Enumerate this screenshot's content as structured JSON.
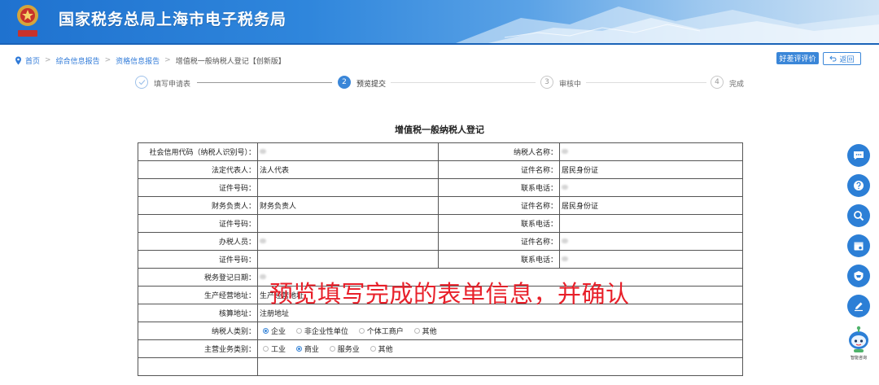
{
  "header": {
    "site_title": "国家税务总局上海市电子税务局"
  },
  "breadcrumb": {
    "items": [
      "首页",
      "综合信息报告",
      "资格信息报告"
    ],
    "current": "增值税一般纳税人登记【创新版】"
  },
  "actions": {
    "evaluate_label": "好差评评价",
    "back_label": "返回"
  },
  "steps": [
    {
      "num": "1",
      "label": "填写申请表",
      "state": "done"
    },
    {
      "num": "2",
      "label": "预览提交",
      "state": "active"
    },
    {
      "num": "3",
      "label": "审核中",
      "state": "todo"
    },
    {
      "num": "4",
      "label": "完成",
      "state": "todo"
    }
  ],
  "form": {
    "title": "增值税一般纳税人登记",
    "rows": [
      {
        "l1": "社会信用代码（纳税人识别号）：",
        "v1": "",
        "l2": "纳税人名称：",
        "v2": ""
      },
      {
        "l1": "法定代表人：",
        "v1": "法人代表",
        "l2": "证件名称：",
        "v2": "居民身份证"
      },
      {
        "l1": "证件号码：",
        "v1": "",
        "l2": "联系电话：",
        "v2": ""
      },
      {
        "l1": "财务负责人：",
        "v1": "财务负责人",
        "l2": "证件名称：",
        "v2": "居民身份证"
      },
      {
        "l1": "证件号码：",
        "v1": "",
        "l2": "联系电话：",
        "v2": ""
      },
      {
        "l1": "办税人员：",
        "v1": "",
        "l2": "证件名称：",
        "v2": ""
      },
      {
        "l1": "证件号码：",
        "v1": "",
        "l2": "联系电话：",
        "v2": ""
      }
    ],
    "full_rows": [
      {
        "label": "税务登记日期：",
        "value": ""
      },
      {
        "label": "生产经营地址：",
        "value": "生产经营地址"
      },
      {
        "label": "核算地址：",
        "value": "注册地址"
      }
    ],
    "taxpayer_type": {
      "label": "纳税人类别：",
      "options": [
        "企业",
        "非企业性单位",
        "个体工商户",
        "其他"
      ],
      "selected": "企业"
    },
    "business_type": {
      "label": "主营业务类别：",
      "options": [
        "工业",
        "商业",
        "服务业",
        "其他"
      ],
      "selected": "商业"
    }
  },
  "annotation": "预览填写完成的表单信息，并确认",
  "float_tools": [
    "chat-icon",
    "help-icon",
    "search-icon",
    "calendar-icon",
    "shield-icon",
    "edit-icon"
  ],
  "assistant": {
    "label": "智能咨询"
  },
  "colors": {
    "primary": "#3a86d8",
    "annotation": "#e8202a",
    "header": "#1f72cf"
  }
}
